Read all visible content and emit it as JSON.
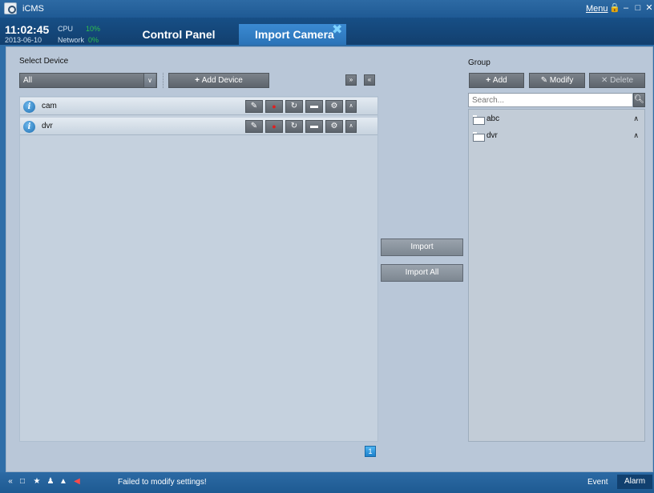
{
  "titlebar": {
    "app_title": "iCMS",
    "menu_label": "Menu",
    "icons": [
      "lock-icon",
      "minimize-icon",
      "restore-icon",
      "close-icon"
    ]
  },
  "header": {
    "time": "11:02:45",
    "date": "2013-06-10",
    "cpu_label": "CPU",
    "cpu_value": "10%",
    "network_label": "Network",
    "network_value": "0%",
    "tabs": [
      {
        "label": "Control Panel",
        "active": false
      },
      {
        "label": "Import Camera",
        "active": true
      }
    ]
  },
  "device_panel": {
    "label": "Select Device",
    "select_value": "All",
    "add_device_label": "Add Device",
    "devices": [
      {
        "name": "cam"
      },
      {
        "name": "dvr"
      }
    ],
    "page": "1"
  },
  "actions": {
    "import_label": "Import",
    "import_all_label": "Import All"
  },
  "group_panel": {
    "label": "Group",
    "add_label": "Add",
    "modify_label": "Modify",
    "delete_label": "Delete",
    "search_placeholder": "Search...",
    "groups": [
      {
        "name": "abc"
      },
      {
        "name": "dvr"
      }
    ]
  },
  "statusbar": {
    "message": "Failed to modify settings!",
    "event_label": "Event",
    "alarm_label": "Alarm"
  },
  "colors": {
    "accent": "#2a73b8",
    "panel": "#b9c7d8",
    "ok_green": "#2fbf4e",
    "record_red": "#e02020"
  }
}
